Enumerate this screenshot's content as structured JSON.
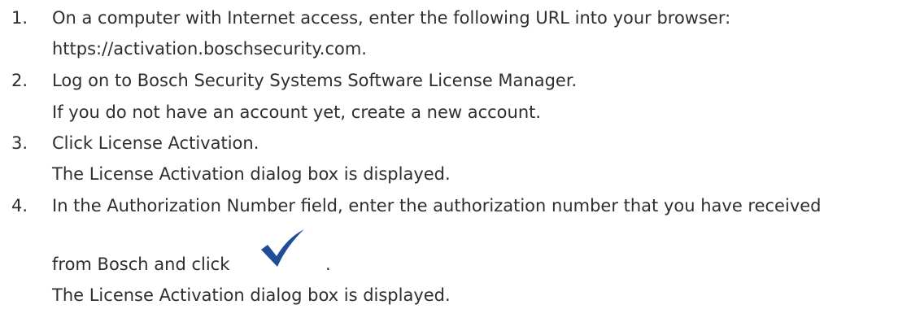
{
  "steps": [
    {
      "number": "1.",
      "lines": [
        "On a computer with Internet access, enter the following URL into your browser:",
        "https://activation.boschsecurity.com."
      ]
    },
    {
      "number": "2.",
      "lines": [
        "Log on to Bosch Security Systems Software License Manager.",
        "If you do not have an account yet, create a new account."
      ]
    },
    {
      "number": "3.",
      "lines": [
        "Click License Activation.",
        "The License Activation dialog box is displayed."
      ]
    },
    {
      "number": "4.",
      "lines": [
        "In the Authorization Number field, enter the authorization number that you have received",
        "from Bosch and click",
        ".",
        "The License Activation dialog box is displayed."
      ]
    }
  ],
  "icons": {
    "confirm": "checkmark-icon",
    "confirm_color": "#1f4e96"
  }
}
